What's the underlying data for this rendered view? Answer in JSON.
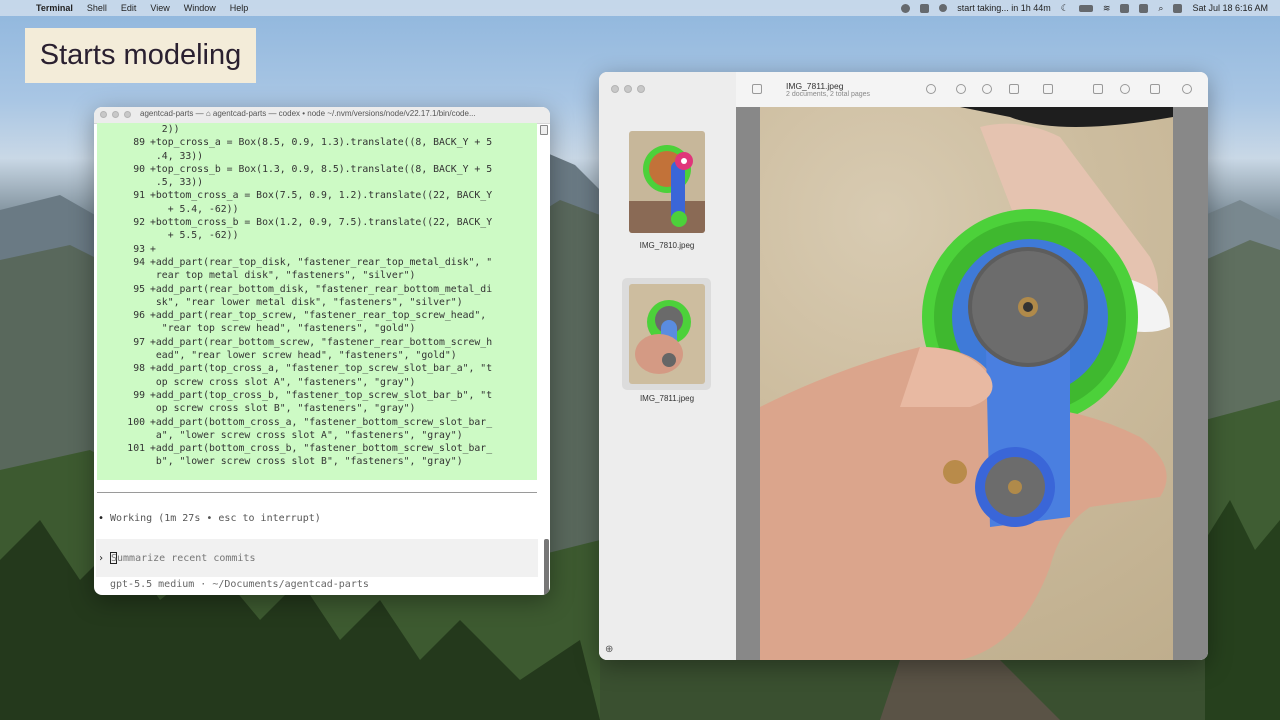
{
  "menubar": {
    "app_name": "Terminal",
    "items": [
      "Shell",
      "Edit",
      "View",
      "Window",
      "Help"
    ],
    "reminder": "start taking... in 1h 44m",
    "datetime": "Sat Jul 18  6:16 AM"
  },
  "title_card": "Starts modeling",
  "terminal": {
    "title": "agentcad-parts — ⌂ agentcad-parts — codex • node ~/.nvm/versions/node/v22.17.1/bin/code...",
    "code_lines": [
      {
        "n": "",
        "t": "  2))"
      },
      {
        "n": "89",
        "t": "+top_cross_a = Box(8.5, 0.9, 1.3).translate((8, BACK_Y + 5"
      },
      {
        "n": "",
        "t": " .4, 33))"
      },
      {
        "n": "90",
        "t": "+top_cross_b = Box(1.3, 0.9, 8.5).translate((8, BACK_Y + 5"
      },
      {
        "n": "",
        "t": " .5, 33))"
      },
      {
        "n": "91",
        "t": "+bottom_cross_a = Box(7.5, 0.9, 1.2).translate((22, BACK_Y"
      },
      {
        "n": "",
        "t": "   + 5.4, -62))"
      },
      {
        "n": "92",
        "t": "+bottom_cross_b = Box(1.2, 0.9, 7.5).translate((22, BACK_Y"
      },
      {
        "n": "",
        "t": "   + 5.5, -62))"
      },
      {
        "n": "93",
        "t": "+"
      },
      {
        "n": "94",
        "t": "+add_part(rear_top_disk, \"fastener_rear_top_metal_disk\", \""
      },
      {
        "n": "",
        "t": " rear top metal disk\", \"fasteners\", \"silver\")"
      },
      {
        "n": "95",
        "t": "+add_part(rear_bottom_disk, \"fastener_rear_bottom_metal_di"
      },
      {
        "n": "",
        "t": " sk\", \"rear lower metal disk\", \"fasteners\", \"silver\")"
      },
      {
        "n": "96",
        "t": "+add_part(rear_top_screw, \"fastener_rear_top_screw_head\","
      },
      {
        "n": "",
        "t": "  \"rear top screw head\", \"fasteners\", \"gold\")"
      },
      {
        "n": "97",
        "t": "+add_part(rear_bottom_screw, \"fastener_rear_bottom_screw_h"
      },
      {
        "n": "",
        "t": " ead\", \"rear lower screw head\", \"fasteners\", \"gold\")"
      },
      {
        "n": "98",
        "t": "+add_part(top_cross_a, \"fastener_top_screw_slot_bar_a\", \"t"
      },
      {
        "n": "",
        "t": " op screw cross slot A\", \"fasteners\", \"gray\")"
      },
      {
        "n": "99",
        "t": "+add_part(top_cross_b, \"fastener_top_screw_slot_bar_b\", \"t"
      },
      {
        "n": "",
        "t": " op screw cross slot B\", \"fasteners\", \"gray\")"
      },
      {
        "n": "100",
        "t": "+add_part(bottom_cross_a, \"fastener_bottom_screw_slot_bar_"
      },
      {
        "n": "",
        "t": " a\", \"lower screw cross slot A\", \"fasteners\", \"gray\")"
      },
      {
        "n": "101",
        "t": "+add_part(bottom_cross_b, \"fastener_bottom_screw_slot_bar_"
      },
      {
        "n": "",
        "t": " b\", \"lower screw cross slot B\", \"fasteners\", \"gray\")"
      }
    ],
    "working": "Working (1m 27s • esc to interrupt)",
    "prompt_placeholder": "Summarize recent commits",
    "status_line": "gpt-5.5 medium · ~/Documents/agentcad-parts"
  },
  "preview": {
    "title": "IMG_7811.jpeg",
    "subtitle": "2 documents, 2 total pages",
    "thumbnails": [
      {
        "label": "IMG_7810.jpeg"
      },
      {
        "label": "IMG_7811.jpeg"
      }
    ]
  },
  "colors": {
    "diff_bg": "#cdfac5",
    "gear_green": "#4cd13a",
    "arm_blue": "#4a7fe0"
  }
}
